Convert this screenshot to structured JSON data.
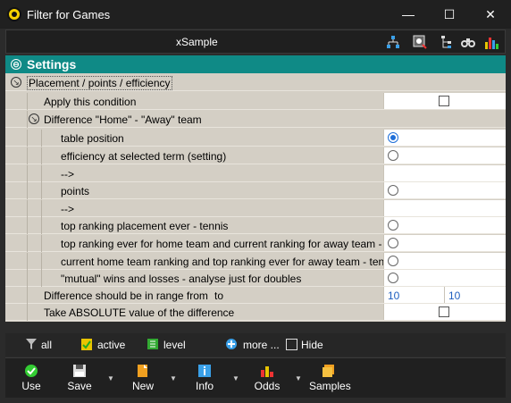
{
  "window": {
    "title": "Filter for Games",
    "minimize": "—",
    "maximize": "☐",
    "close": "✕"
  },
  "toolbar": {
    "label": "xSample",
    "icons": [
      "hierarchy-icon",
      "settings-filter-icon",
      "tree-icon",
      "binoculars-icon",
      "bar-chart-icon"
    ]
  },
  "settings": {
    "header": "Settings",
    "group": "Placement / points / efficiency",
    "apply_condition": "Apply this condition",
    "subgroup": "Difference \"Home\" - \"Away\" team",
    "options": [
      {
        "label": "table position",
        "type": "radio",
        "selected": true
      },
      {
        "label": "efficiency at selected term (setting)",
        "type": "radio",
        "selected": false
      },
      {
        "label": "-->",
        "type": "text"
      },
      {
        "label": "points",
        "type": "radio",
        "selected": false
      },
      {
        "label": "-->",
        "type": "text"
      },
      {
        "label": "top ranking placement ever - tennis",
        "type": "radio",
        "selected": false
      },
      {
        "label": "top ranking ever for home team and current ranking for away team - tennis",
        "type": "radio",
        "selected": false
      },
      {
        "label": "current home team ranking and top ranking ever for away team - tennis",
        "type": "radio",
        "selected": false
      },
      {
        "label": "\"mutual\" wins and losses - analyse just for doubles",
        "type": "radio",
        "selected": false
      }
    ],
    "range_label": "Difference should be in range from",
    "range_to": "to",
    "range_from_value": "10",
    "range_to_value": "10",
    "absolute_label": "Take ABSOLUTE value of the difference"
  },
  "filterbar": {
    "all": "all",
    "active": "active",
    "level": "level",
    "more": "more ...",
    "hide": "Hide"
  },
  "actions": {
    "use": "Use",
    "save": "Save",
    "new": "New",
    "info": "Info",
    "odds": "Odds",
    "samples": "Samples"
  },
  "colors": {
    "header_teal": "#0f8a86",
    "panel_beige": "#d4cfc5",
    "radio_blue": "#1e6fd9",
    "value_blue": "#1f5fbf"
  }
}
